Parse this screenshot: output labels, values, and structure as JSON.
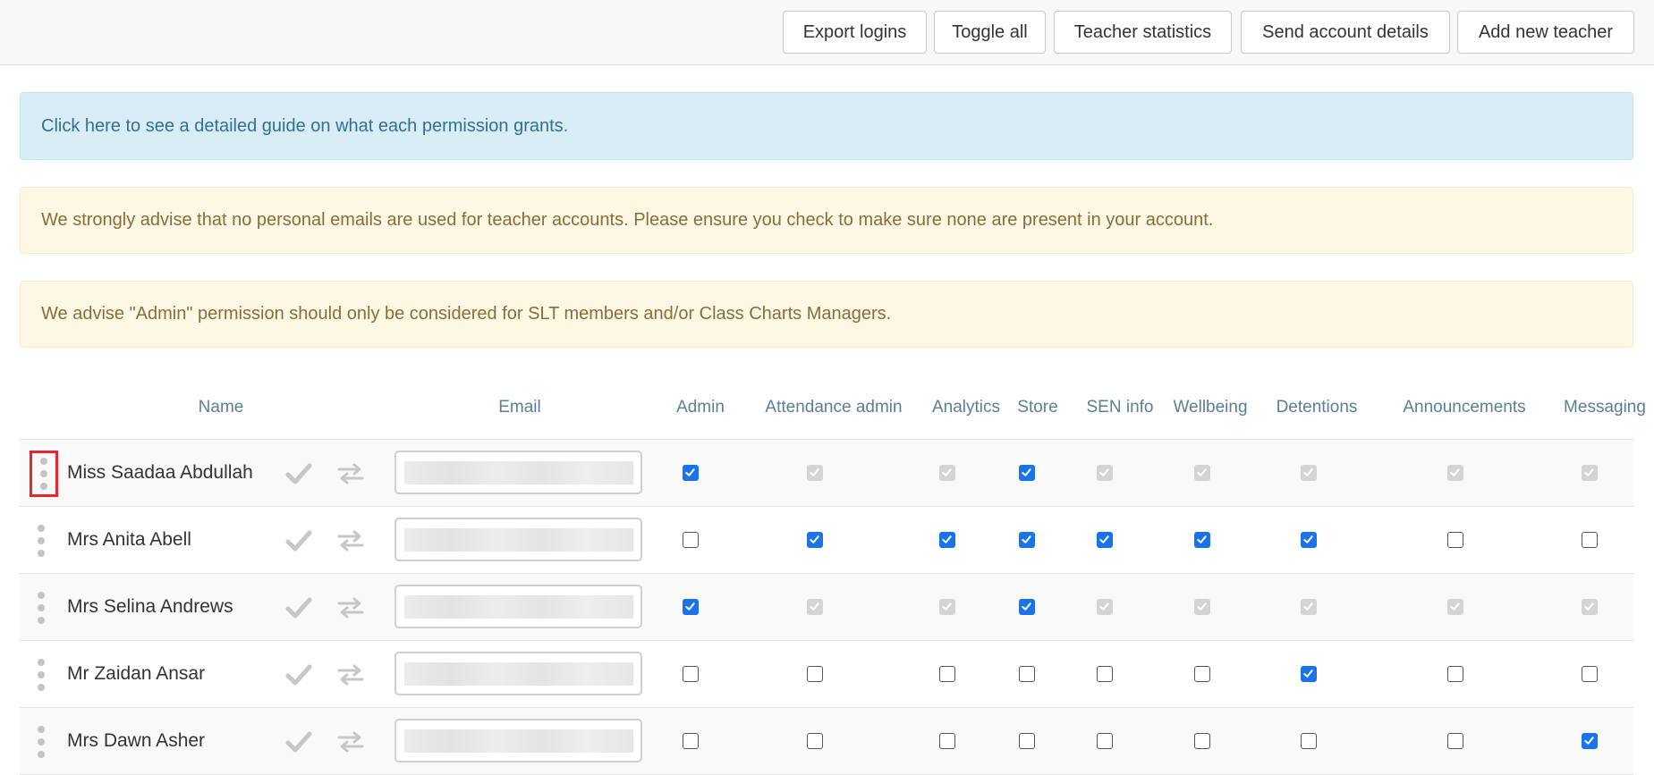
{
  "toolbar": {
    "export_logins": "Export logins",
    "toggle_all": "Toggle all",
    "teacher_statistics": "Teacher statistics",
    "send_account_details": "Send account details",
    "add_new_teacher": "Add new teacher"
  },
  "alerts": {
    "guide": "Click here to see a detailed guide on what each permission grants.",
    "personal_emails": "We strongly advise that no personal emails are used for teacher accounts. Please ensure you check to make sure none are present in your account.",
    "admin_permission": "We advise \"Admin\" permission should only be considered for SLT members and/or Class Charts Managers."
  },
  "table": {
    "headers": {
      "name": "Name",
      "email": "Email",
      "admin": "Admin",
      "attendance_admin": "Attendance admin",
      "analytics": "Analytics",
      "store": "Store",
      "sen_info": "SEN info",
      "wellbeing": "Wellbeing",
      "detentions": "Detentions",
      "announcements": "Announcements",
      "messaging": "Messaging"
    },
    "permission_order": [
      "admin",
      "attendance_admin",
      "analytics",
      "store",
      "sen_info",
      "wellbeing",
      "detentions",
      "announcements",
      "messaging"
    ],
    "rows": [
      {
        "name": "Miss Saadaa Abdullah",
        "email": "",
        "permissions": [
          "on",
          "dis",
          "dis",
          "on",
          "dis",
          "dis",
          "dis",
          "dis",
          "dis"
        ]
      },
      {
        "name": "Mrs Anita Abell",
        "email": "",
        "permissions": [
          "off",
          "on",
          "on",
          "on",
          "on",
          "on",
          "on",
          "off",
          "off"
        ]
      },
      {
        "name": "Mrs Selina Andrews",
        "email": "",
        "permissions": [
          "on",
          "dis",
          "dis",
          "on",
          "dis",
          "dis",
          "dis",
          "dis",
          "dis"
        ]
      },
      {
        "name": "Mr Zaidan Ansar",
        "email": "",
        "permissions": [
          "off",
          "off",
          "off",
          "off",
          "off",
          "off",
          "on",
          "off",
          "off"
        ]
      },
      {
        "name": "Mrs Dawn Asher",
        "email": "",
        "permissions": [
          "off",
          "off",
          "off",
          "off",
          "off",
          "off",
          "off",
          "off",
          "on"
        ]
      }
    ]
  },
  "colors": {
    "checkbox_checked": "#1a73e8",
    "checkbox_disabled": "#d4d4d4",
    "info_alert_bg": "#d9edf7",
    "warning_alert_bg": "#fcf8e3",
    "highlight_box": "#e8262a"
  },
  "icons": {
    "row_handle": "vertical-dots-icon",
    "confirm": "checkmark-icon",
    "transfer": "swap-arrows-icon"
  }
}
